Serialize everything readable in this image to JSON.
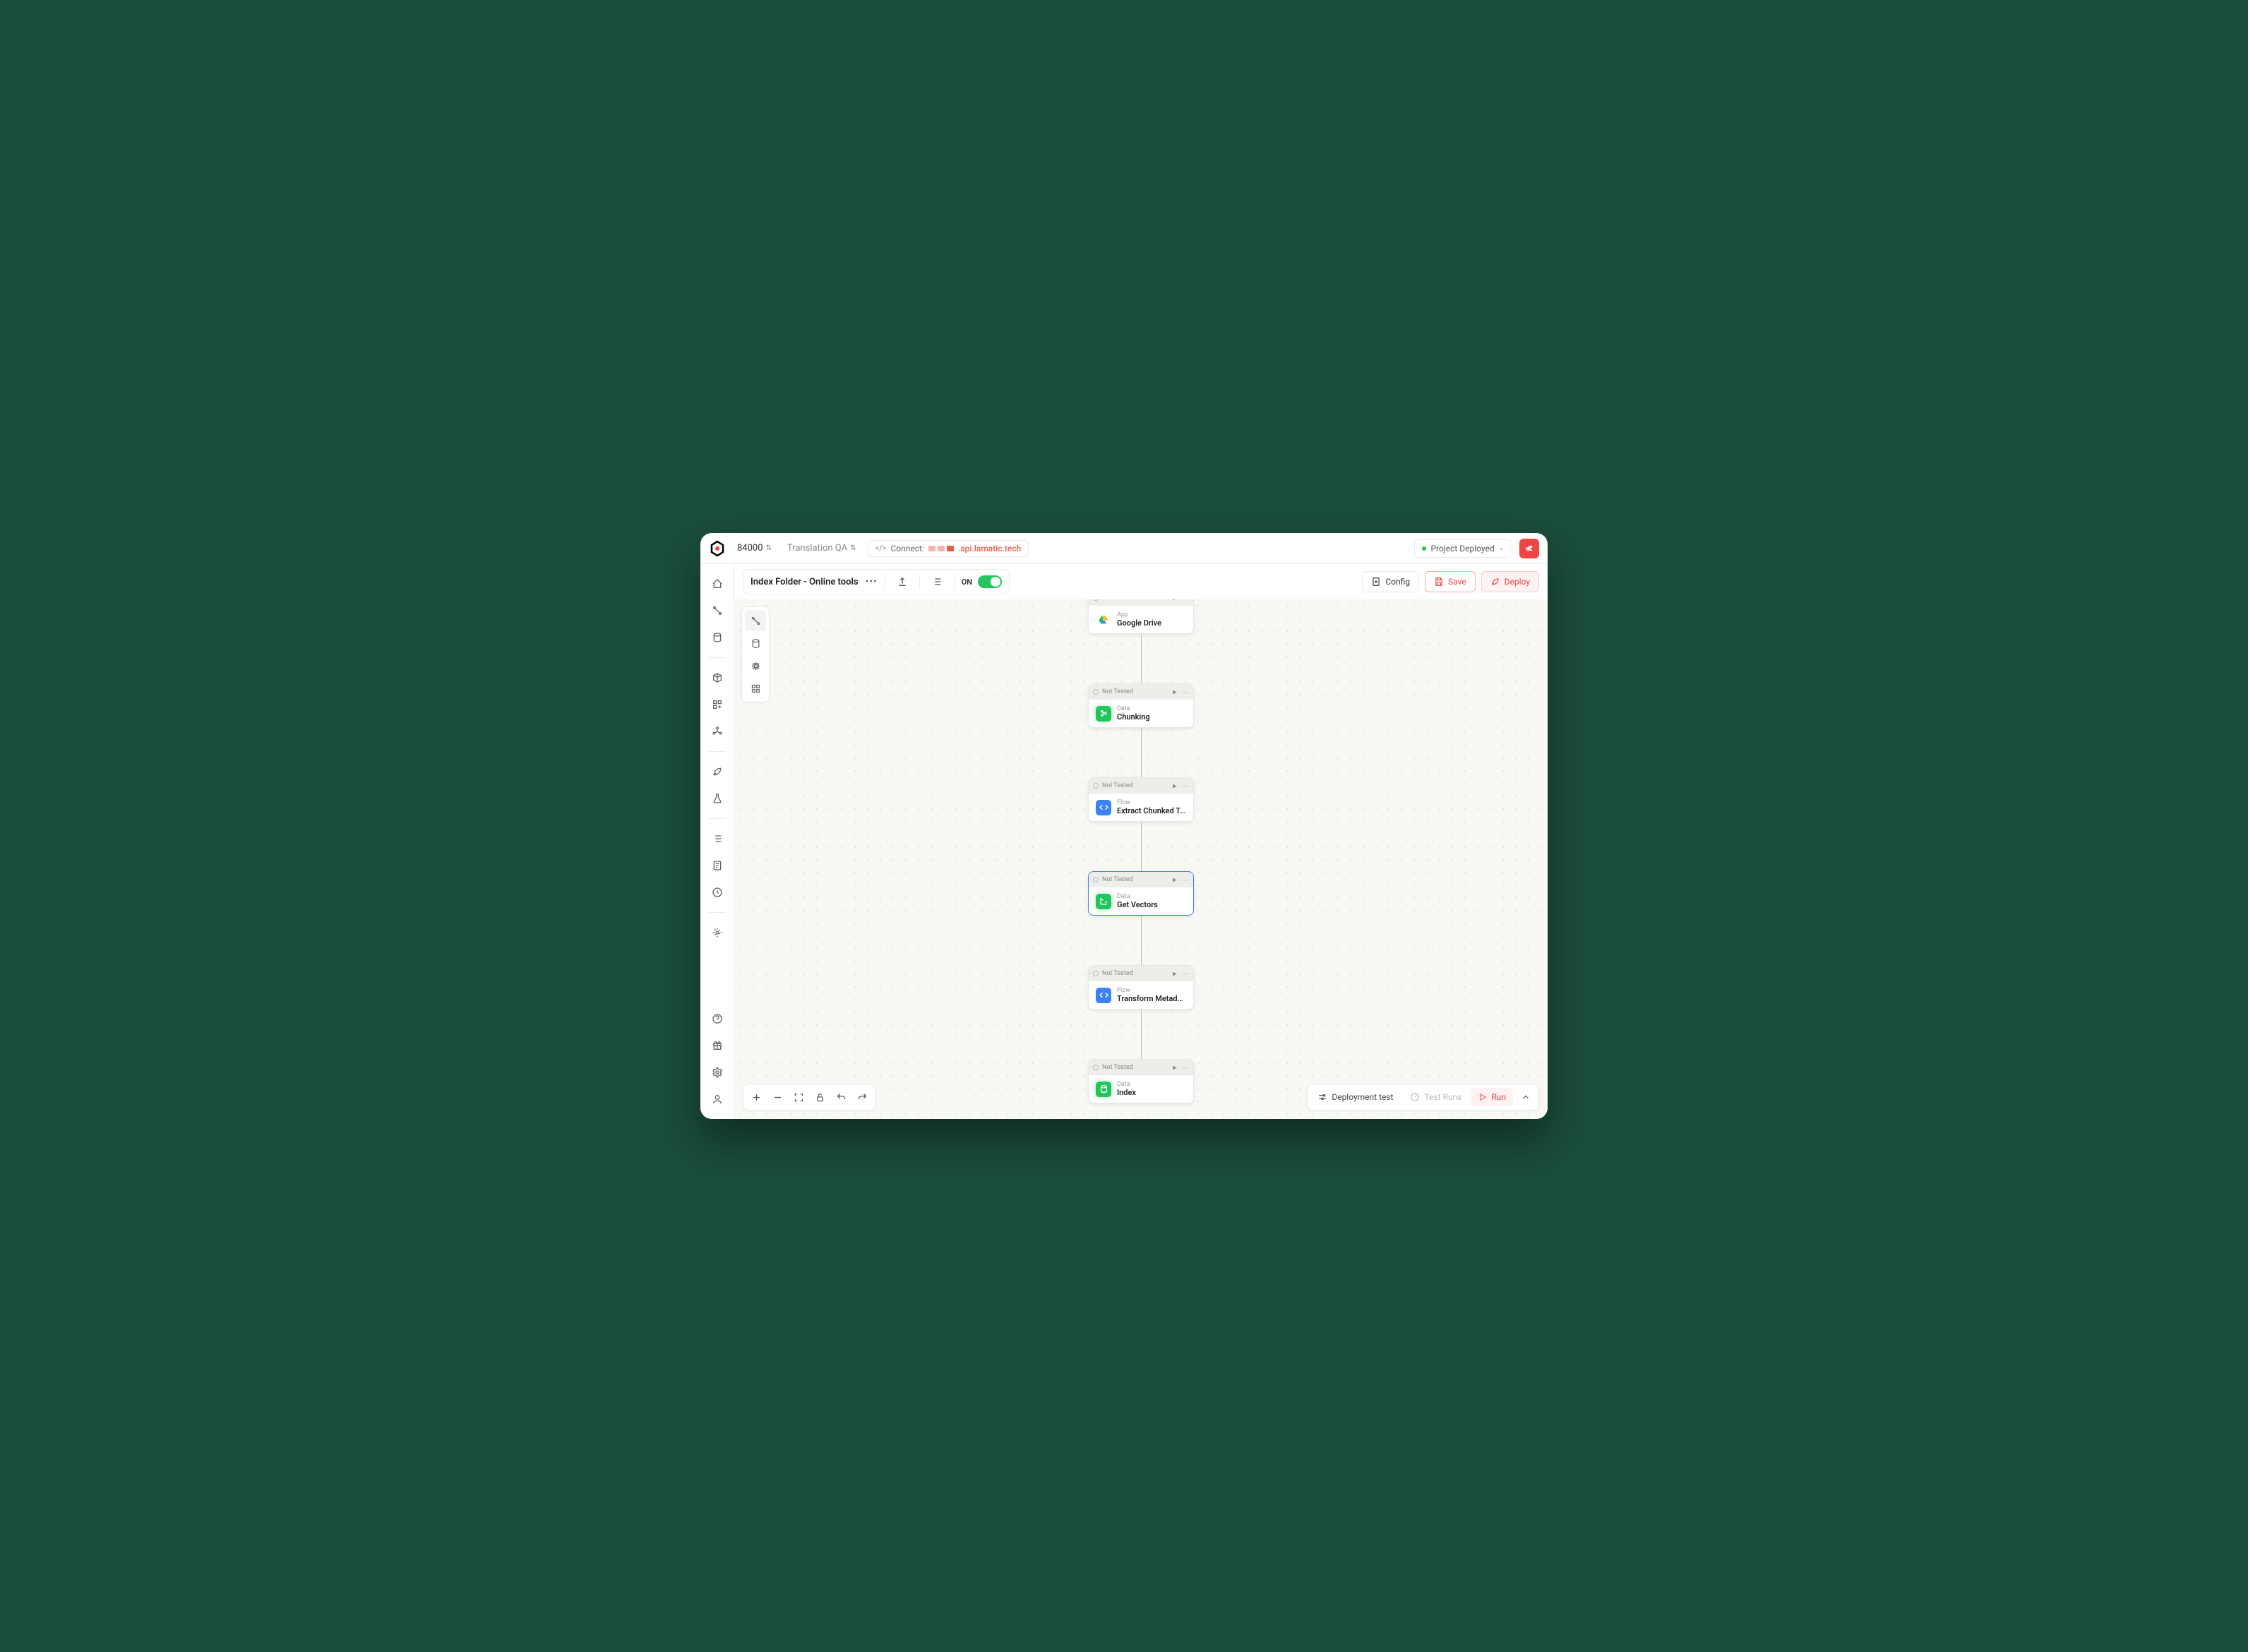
{
  "topbar": {
    "project_id": "84000",
    "project_name": "Translation QA",
    "connect_label": "Connect:",
    "api_url_suffix": ".api.lamatic.tech",
    "status_label": "Project Deployed"
  },
  "toolbar": {
    "flow_title": "Index Folder - Online tools",
    "toggle_label": "ON",
    "config_label": "Config",
    "save_label": "Save",
    "deploy_label": "Deploy"
  },
  "nodes": [
    {
      "status": "Not Tested",
      "type": "App",
      "name": "Google Drive",
      "icon": "gdrive",
      "selected": false
    },
    {
      "status": "Not Tested",
      "type": "Data",
      "name": "Chunking",
      "icon": "green-scissors",
      "selected": false
    },
    {
      "status": "Not Tested",
      "type": "Flow",
      "name": "Extract Chunked Text",
      "icon": "blue-code",
      "selected": false
    },
    {
      "status": "Not Tested",
      "type": "Data",
      "name": "Get Vectors",
      "icon": "green-vectors",
      "selected": true
    },
    {
      "status": "Not Tested",
      "type": "Flow",
      "name": "Transform Metadata",
      "icon": "blue-code",
      "selected": false
    },
    {
      "status": "Not Tested",
      "type": "Data",
      "name": "Index",
      "icon": "green-db",
      "selected": false
    }
  ],
  "bottom": {
    "deployment_test": "Deployment test",
    "test_runs": "Test Runs",
    "run": "Run"
  }
}
